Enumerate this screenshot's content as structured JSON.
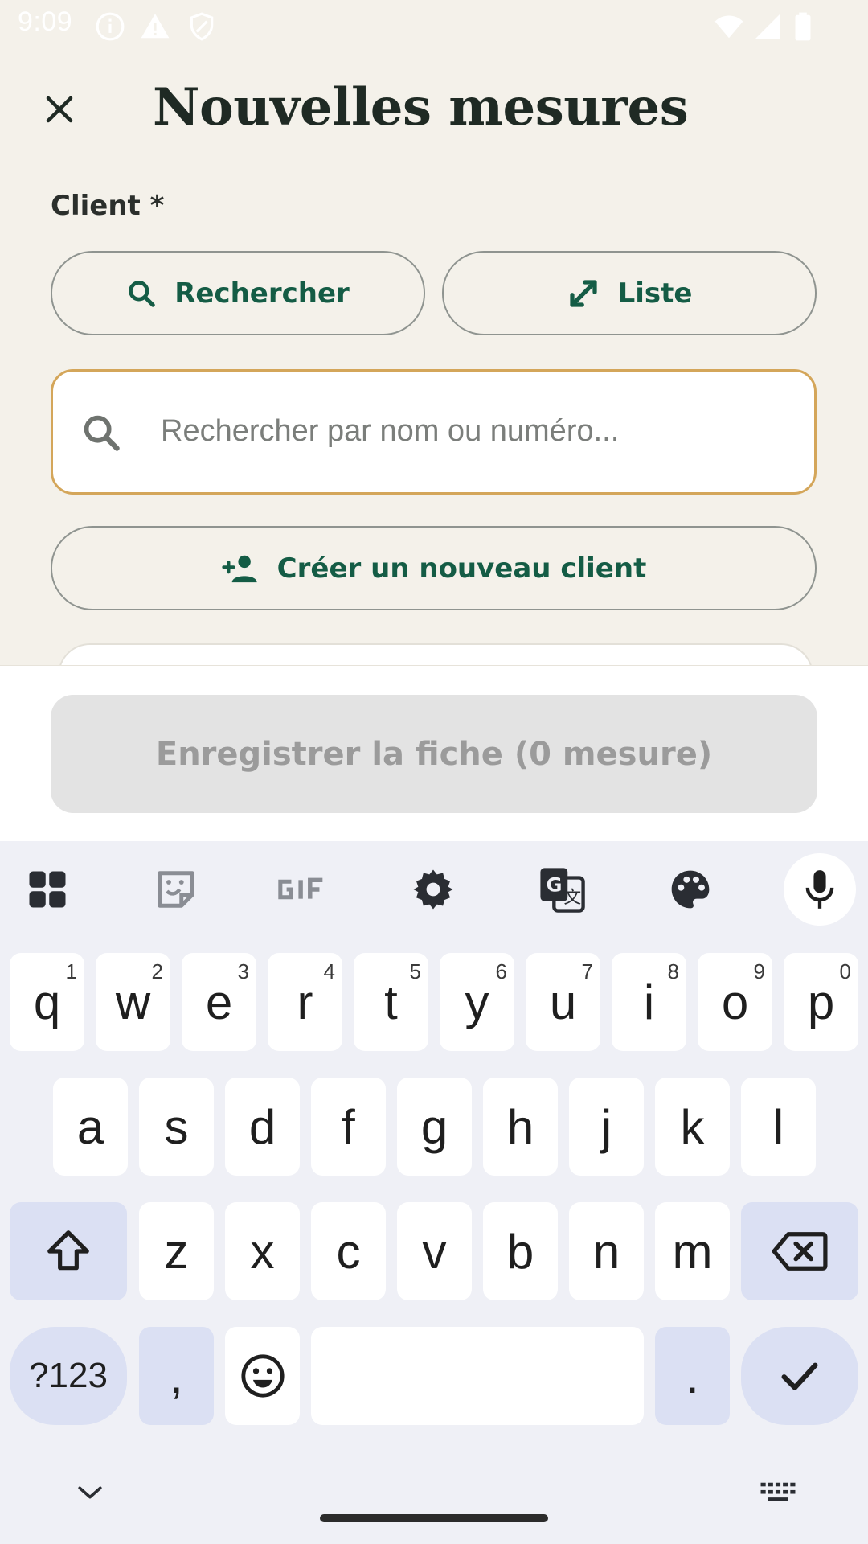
{
  "status_bar": {
    "time": "9:09"
  },
  "header": {
    "title": "Nouvelles mesures"
  },
  "form": {
    "client_label": "Client *",
    "search_button": "Rechercher",
    "list_button": "Liste",
    "search_placeholder": "Rechercher par nom ou numéro...",
    "create_client_button": "Créer un nouveau client",
    "save_button": "Enregistrer la fiche  (0 mesure)"
  },
  "keyboard": {
    "row1": [
      {
        "k": "q",
        "s": "1"
      },
      {
        "k": "w",
        "s": "2"
      },
      {
        "k": "e",
        "s": "3"
      },
      {
        "k": "r",
        "s": "4"
      },
      {
        "k": "t",
        "s": "5"
      },
      {
        "k": "y",
        "s": "6"
      },
      {
        "k": "u",
        "s": "7"
      },
      {
        "k": "i",
        "s": "8"
      },
      {
        "k": "o",
        "s": "9"
      },
      {
        "k": "p",
        "s": "0"
      }
    ],
    "row2": [
      "a",
      "s",
      "d",
      "f",
      "g",
      "h",
      "j",
      "k",
      "l"
    ],
    "row3": [
      "z",
      "x",
      "c",
      "v",
      "b",
      "n",
      "m"
    ],
    "symbols_key": "?123",
    "comma_key": ",",
    "period_key": "."
  },
  "colors": {
    "accent": "#145c45",
    "focus_border": "#d4a65a",
    "background": "#f4f1ea"
  }
}
